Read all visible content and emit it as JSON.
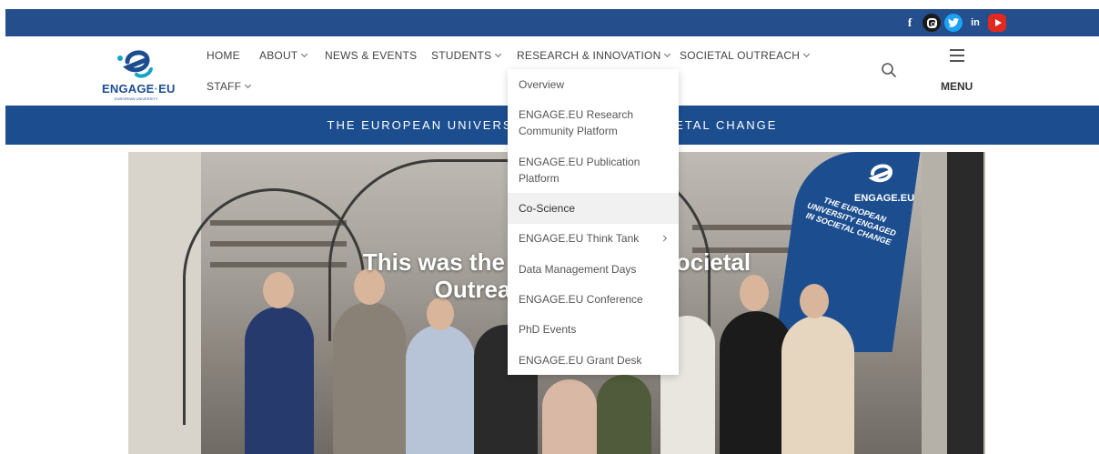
{
  "social": {
    "facebook": "f",
    "linkedin": "in",
    "icons": [
      "facebook-icon",
      "instagram-icon",
      "twitter-icon",
      "linkedin-icon",
      "youtube-icon"
    ]
  },
  "logo": {
    "text_main": "ENGAGE",
    "text_dot": "·",
    "text_end": "EU",
    "subtitle": "EUROPEAN UNIVERSITY"
  },
  "nav": {
    "home": "HOME",
    "about": "ABOUT",
    "news": "NEWS & EVENTS",
    "students": "STUDENTS",
    "research": "RESEARCH & INNOVATION",
    "outreach": "SOCIETAL OUTREACH",
    "staff": "STAFF",
    "menu": "MENU"
  },
  "banner": {
    "text": "THE EUROPEAN UNIVERSITY ENGAGED IN SOCIETAL CHANGE"
  },
  "hero": {
    "title_line1": "This was the ENGAGE.EU Societal",
    "title_line2": "Outreach Symposium",
    "flag_text": "THE EUROPEAN UNIVERSITY ENGAGED IN SOCIETAL CHANGE",
    "flag_logo": "ENGAGE.EU"
  },
  "dropdown": {
    "items": [
      {
        "label": "Overview"
      },
      {
        "label": "ENGAGE.EU Research Community Platform"
      },
      {
        "label": "ENGAGE.EU Publication Platform"
      },
      {
        "label": "Co-Science"
      },
      {
        "label": "ENGAGE.EU Think Tank"
      },
      {
        "label": "Data Management Days"
      },
      {
        "label": "ENGAGE.EU Conference"
      },
      {
        "label": "PhD Events"
      },
      {
        "label": "ENGAGE.EU Grant Desk"
      }
    ]
  },
  "colors": {
    "brand_blue": "#1c4e8f",
    "topbar_blue": "#244f8c",
    "accent_cyan": "#15a3c8"
  }
}
